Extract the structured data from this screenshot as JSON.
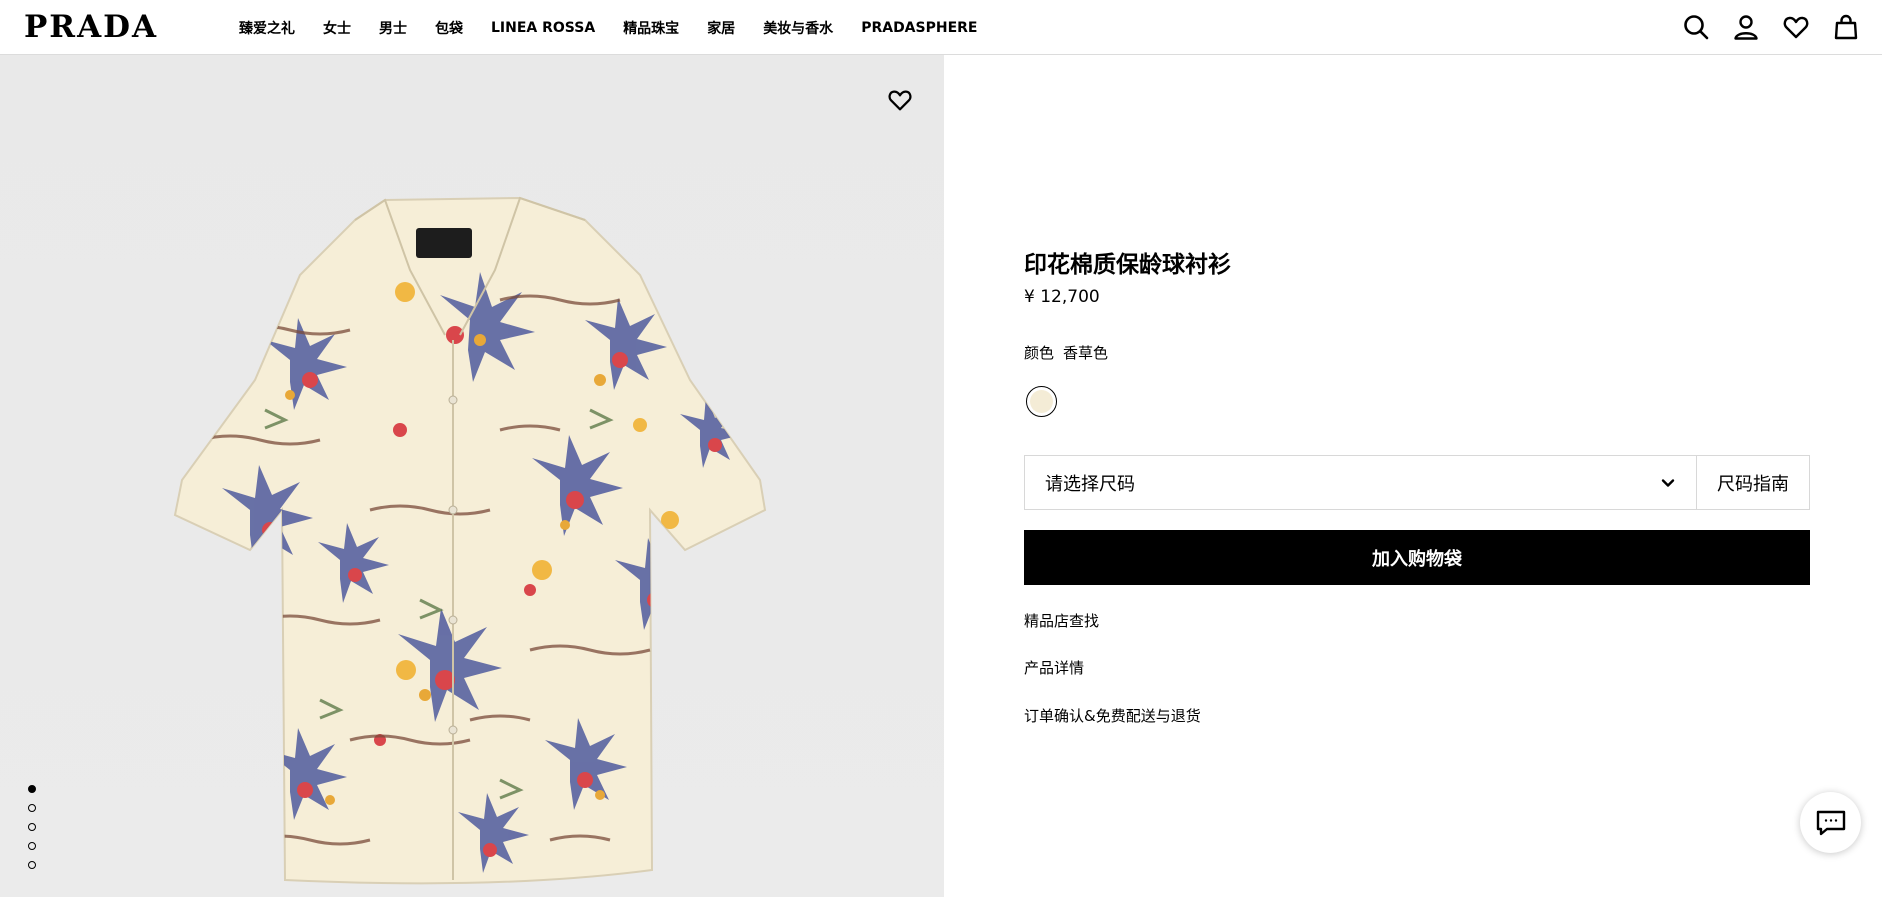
{
  "brand": {
    "logo": "PRADA"
  },
  "nav": {
    "items": [
      {
        "label": "臻爱之礼"
      },
      {
        "label": "女士"
      },
      {
        "label": "男士"
      },
      {
        "label": "包袋"
      },
      {
        "label": "LINEA ROSSA"
      },
      {
        "label": "精品珠宝"
      },
      {
        "label": "家居"
      },
      {
        "label": "美妆与香水"
      },
      {
        "label": "PRADASPHERE"
      }
    ]
  },
  "header_icons": [
    "search-icon",
    "account-icon",
    "wishlist-icon",
    "shopping-bag-icon"
  ],
  "gallery": {
    "image": "printed-bowling-shirt-photo",
    "slides": 5,
    "active_slide": 1
  },
  "product": {
    "title": "印花棉质保龄球衬衫",
    "price": "¥ 12,700",
    "color_label": "颜色",
    "color_value": "香草色",
    "swatch_color": "#f4ecd6",
    "size_placeholder": "请选择尺码",
    "size_guide": "尺码指南",
    "add_to_bag": "加入购物袋",
    "links": [
      {
        "label": "精品店查找"
      },
      {
        "label": "产品详情"
      },
      {
        "label": "订单确认&免费配送与退货"
      }
    ]
  },
  "chat": {
    "icon": "chat-icon"
  }
}
